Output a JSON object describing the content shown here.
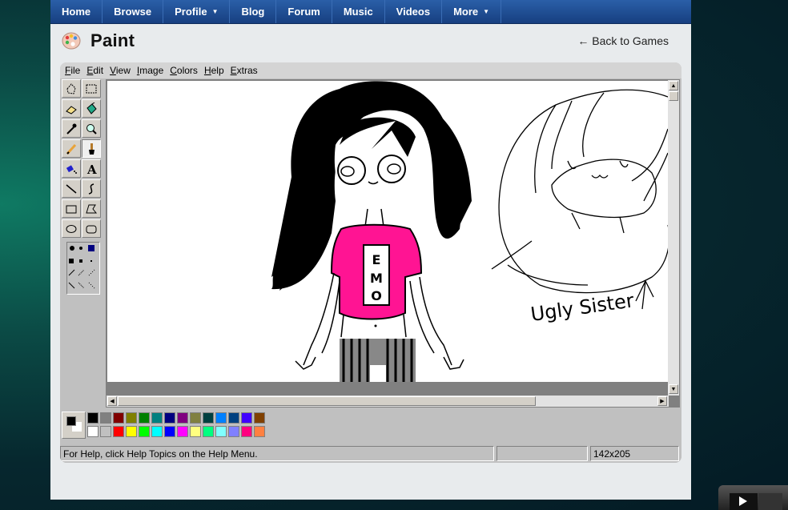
{
  "nav": {
    "items": [
      {
        "label": "Home"
      },
      {
        "label": "Browse"
      },
      {
        "label": "Profile",
        "dropdown": true
      },
      {
        "label": "Blog"
      },
      {
        "label": "Forum"
      },
      {
        "label": "Music"
      },
      {
        "label": "Videos"
      },
      {
        "label": "More",
        "dropdown": true
      }
    ]
  },
  "header": {
    "title": "Paint",
    "back_link": "← Back to Games",
    "logo_icon": "paint-palette-icon"
  },
  "paint": {
    "menu": [
      "File",
      "Edit",
      "View",
      "Image",
      "Colors",
      "Help",
      "Extras"
    ],
    "tools": [
      "free-select-icon",
      "rect-select-icon",
      "eraser-icon",
      "fill-bucket-icon",
      "color-picker-icon",
      "magnifier-icon",
      "pencil-icon",
      "brush-icon",
      "airbrush-icon",
      "text-icon",
      "line-icon",
      "curve-icon",
      "rectangle-icon",
      "polygon-icon",
      "ellipse-icon",
      "rounded-rect-icon"
    ],
    "active_tool": "brush-icon",
    "canvas_annotation": "Ugly Sister",
    "shirt_text": "EMO",
    "status": {
      "help": "For Help, click Help Topics on the Help Menu.",
      "position": "",
      "size": "142x205"
    },
    "colors": {
      "primary": "#000000",
      "secondary": "#ffffff",
      "palette_top": [
        "#000000",
        "#808080",
        "#800000",
        "#808000",
        "#008000",
        "#008080",
        "#000080",
        "#800080",
        "#808040",
        "#004040",
        "#0080ff",
        "#004080",
        "#4000ff",
        "#804000"
      ],
      "palette_bottom": [
        "#ffffff",
        "#c0c0c0",
        "#ff0000",
        "#ffff00",
        "#00ff00",
        "#00ffff",
        "#0000ff",
        "#ff00ff",
        "#ffff80",
        "#00ff80",
        "#80ffff",
        "#8080ff",
        "#ff0080",
        "#ff8040"
      ]
    }
  }
}
